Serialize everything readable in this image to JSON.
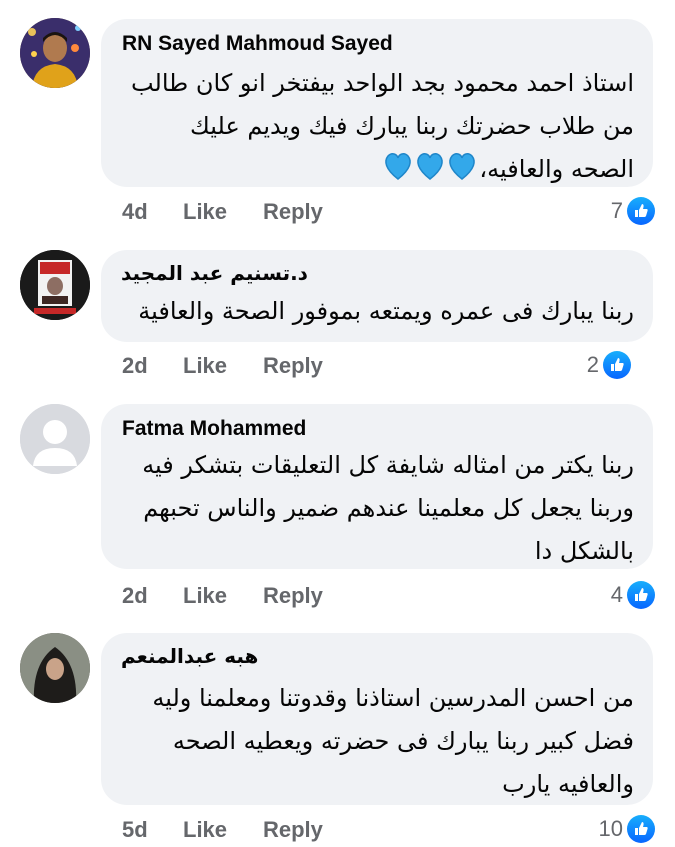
{
  "labels": {
    "like": "Like",
    "reply": "Reply"
  },
  "colors": {
    "like_blue": "#0866ff",
    "bubble": "#f0f2f5",
    "meta_grey": "#65676b",
    "heart": "#33a8ea"
  },
  "comments": [
    {
      "author": "RN Sayed Mahmoud Sayed",
      "lines": [
        "استاذ احمد محمود بجد الواحد بيفتخر انو كان طالب",
        "من طلاب حضرتك ربنا يبارك فيك ويديم عليك",
        "الصحه والعافيه،"
      ],
      "emoji": "💙💙💙",
      "time": "4d",
      "reactions": "7",
      "avatar_icon": "user-photo-avatar"
    },
    {
      "author": "د.تسنيم عبد المجيد",
      "lines": [
        "ربنا يبارك فى عمره ويمتعه بموفور الصحة والعافية"
      ],
      "time": "2d",
      "reactions": "2",
      "avatar_icon": "framed-photo-avatar"
    },
    {
      "author": "Fatma Mohammed",
      "lines": [
        "ربنا يكتر من امثاله شايفة كل التعليقات بتشكر فيه",
        "وربنا يجعل كل معلمينا عندهم ضمير والناس تحبهم",
        "بالشكل دا"
      ],
      "time": "2d",
      "reactions": "4",
      "avatar_icon": "default-profile-avatar"
    },
    {
      "author": "هبه عبدالمنعم",
      "lines": [
        "من احسن المدرسين استاذنا وقدوتنا ومعلمنا ولیه",
        "فضل كبير ربنا يبارك فى حضرته ويعطيه الصحه",
        "والعافيه يارب"
      ],
      "time": "5d",
      "reactions": "10",
      "avatar_icon": "woman-photo-avatar"
    }
  ]
}
